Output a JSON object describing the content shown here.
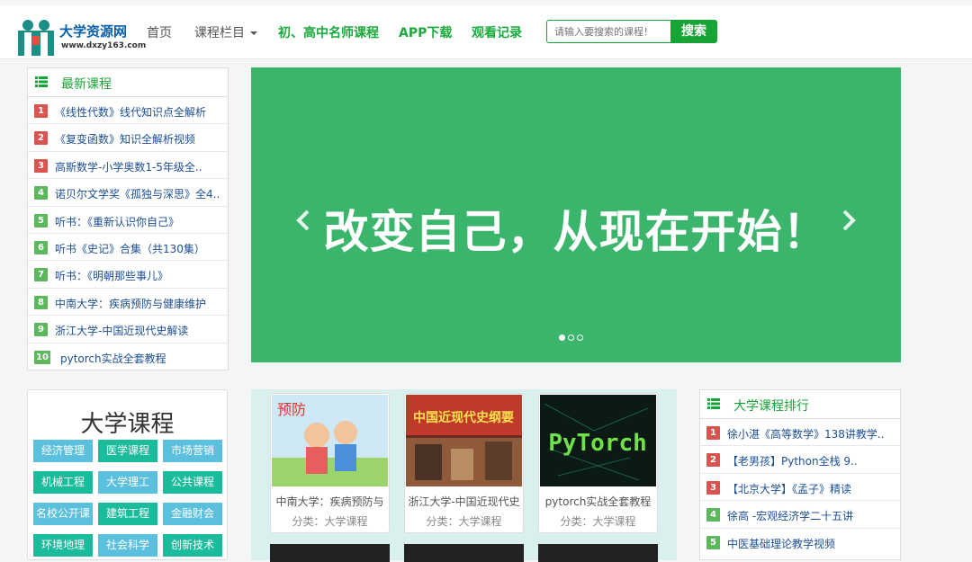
{
  "header": {
    "logo_title": "大学资源网",
    "logo_url": "www.dxzy163.com",
    "nav": {
      "home": "首页",
      "courses": "课程栏目",
      "highschool": "初、高中名师课程",
      "app": "APP下载",
      "history": "观看记录"
    },
    "search": {
      "placeholder": "请输入要搜索的课程！",
      "button": "搜索"
    }
  },
  "latest": {
    "title": "最新课程",
    "items": [
      {
        "rank": "1",
        "text": "《线性代数》线代知识点全解析"
      },
      {
        "rank": "2",
        "text": "《复变函数》知识全解析视频"
      },
      {
        "rank": "3",
        "text": "高斯数学-小学奥数1-5年级全.."
      },
      {
        "rank": "4",
        "text": "诺贝尔文学奖《孤独与深思》全4.."
      },
      {
        "rank": "5",
        "text": "听书：《重新认识你自己》"
      },
      {
        "rank": "6",
        "text": "听书《史记》合集（共130集）"
      },
      {
        "rank": "7",
        "text": "听书：《明朝那些事儿》"
      },
      {
        "rank": "8",
        "text": "中南大学：疾病预防与健康维护"
      },
      {
        "rank": "9",
        "text": "浙江大学-中国近现代史解读"
      },
      {
        "rank": "10",
        "text": "pytorch实战全套教程"
      }
    ]
  },
  "banner": {
    "slogan": "改变自己，从现在开始！",
    "slide_count": 3,
    "active_slide": 1
  },
  "categories": {
    "title": "大学课程",
    "tags": [
      "经济管理",
      "医学课程",
      "市场营销",
      "机械工程",
      "大学理工",
      "公共课程",
      "名校公开课",
      "建筑工程",
      "金融财会",
      "环境地理",
      "社会科学",
      "创新技术"
    ]
  },
  "videos": [
    {
      "title": "中南大学：疾病预防与",
      "category": "分类：大学课程",
      "thumb_text": "预防"
    },
    {
      "title": "浙江大学-中国近现代史",
      "category": "分类：大学课程",
      "thumb_text": "中国近现代史纲要"
    },
    {
      "title": "pytorch实战全套教程",
      "category": "分类：大学课程",
      "thumb_text": "PyTorch"
    }
  ],
  "ranking": {
    "title": "大学课程排行",
    "items": [
      {
        "rank": "1",
        "text": "徐小湛《高等数学》138讲教学.."
      },
      {
        "rank": "2",
        "text": "【老男孩】Python全栈 9.."
      },
      {
        "rank": "3",
        "text": "【北京大学】《孟子》精读"
      },
      {
        "rank": "4",
        "text": "徐高 -宏观经济学二十五讲"
      },
      {
        "rank": "5",
        "text": "中医基础理论教学视频"
      }
    ]
  },
  "colors": {
    "brand_green": "#18a336",
    "banner_green": "#3cb56c",
    "rank_red": "#d9534f",
    "rank_green": "#5cb85c",
    "link_blue": "#1c4f94"
  }
}
